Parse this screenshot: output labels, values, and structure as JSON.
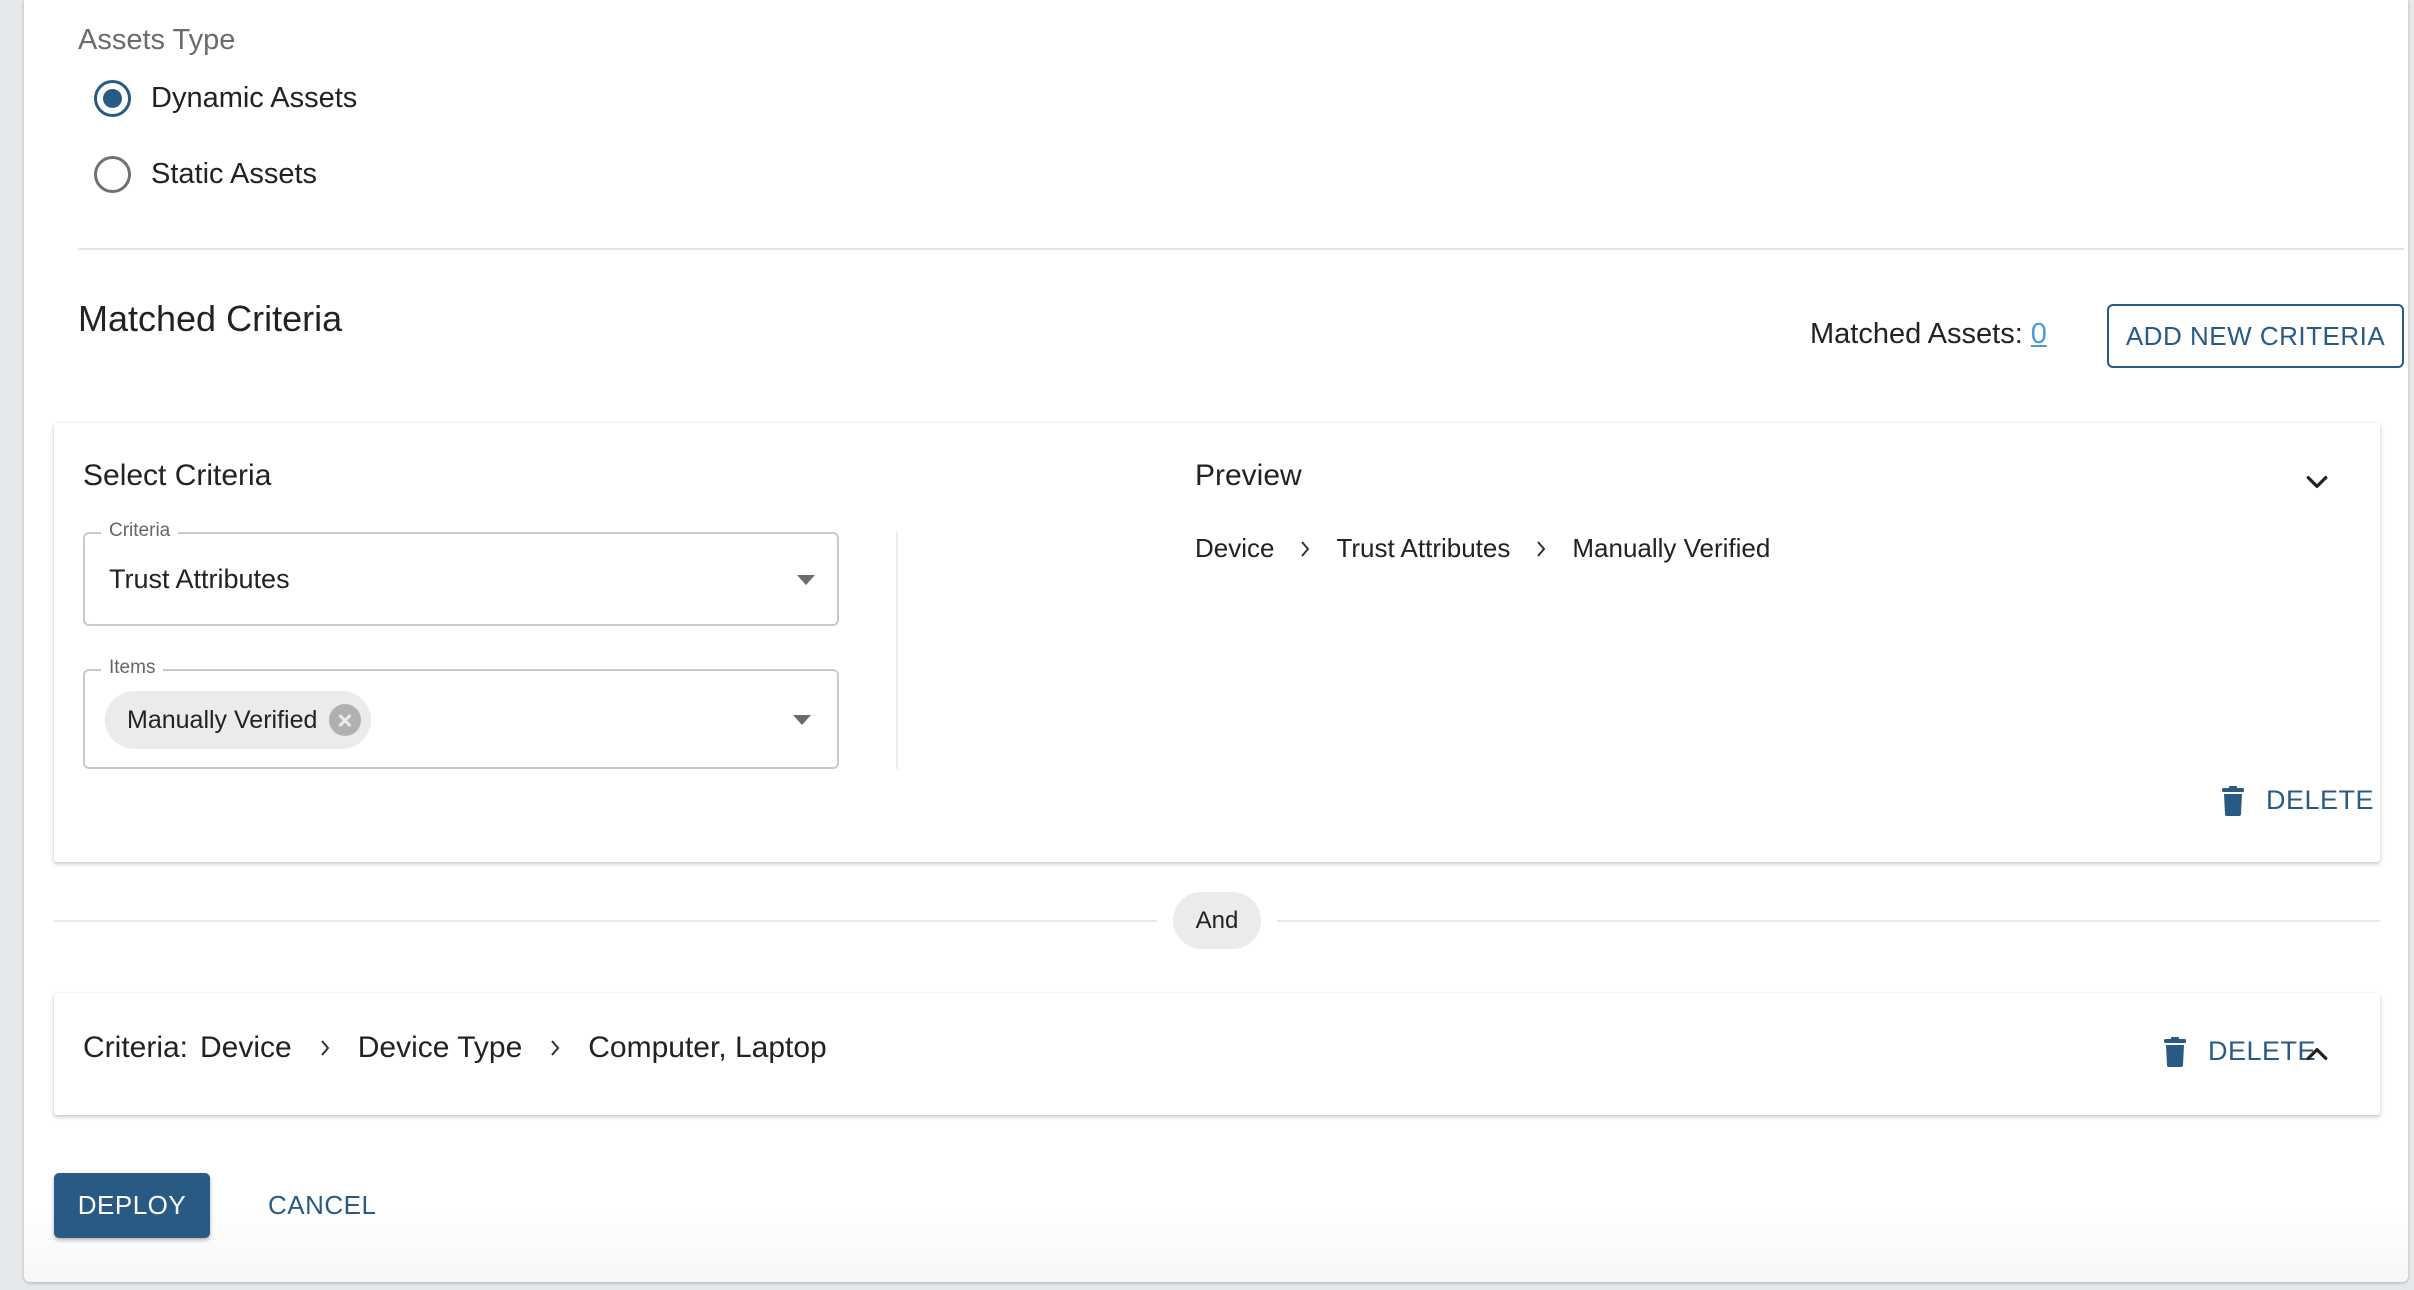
{
  "assets_type": {
    "label": "Assets Type",
    "options": [
      {
        "label": "Dynamic Assets",
        "selected": true
      },
      {
        "label": "Static Assets",
        "selected": false
      }
    ]
  },
  "matched_criteria": {
    "title": "Matched Criteria",
    "matched_assets_label": "Matched Assets:",
    "matched_assets_count": "0",
    "add_button_label": "ADD NEW CRITERIA"
  },
  "criteria_cards": [
    {
      "expanded": true,
      "select_title": "Select Criteria",
      "criteria_field": {
        "label": "Criteria",
        "value": "Trust Attributes"
      },
      "items_field": {
        "label": "Items",
        "chips": [
          "Manually Verified"
        ]
      },
      "preview_title": "Preview",
      "preview_path": [
        "Device",
        "Trust Attributes",
        "Manually Verified"
      ],
      "delete_label": "DELETE"
    },
    {
      "expanded": false,
      "summary_prefix": "Criteria:",
      "path": [
        "Device",
        "Device Type",
        "Computer, Laptop"
      ],
      "delete_label": "DELETE"
    }
  ],
  "connector_label": "And",
  "actions": {
    "deploy_label": "DEPLOY",
    "cancel_label": "CANCEL"
  },
  "colors": {
    "primary": "#285a84",
    "link": "#4a9ad8",
    "chip_bg": "#ebebeb",
    "page_bg": "#e6e9ec"
  },
  "icons": {
    "radio_selected": "radio-checked-icon",
    "radio_unselected": "radio-unchecked-icon",
    "dropdown": "caret-down-icon",
    "chip_remove": "cancel-circle-icon",
    "breadcrumb_separator": "chevron-right-icon",
    "delete": "trash-icon",
    "collapse": "chevron-down-icon",
    "expand": "chevron-up-icon"
  }
}
